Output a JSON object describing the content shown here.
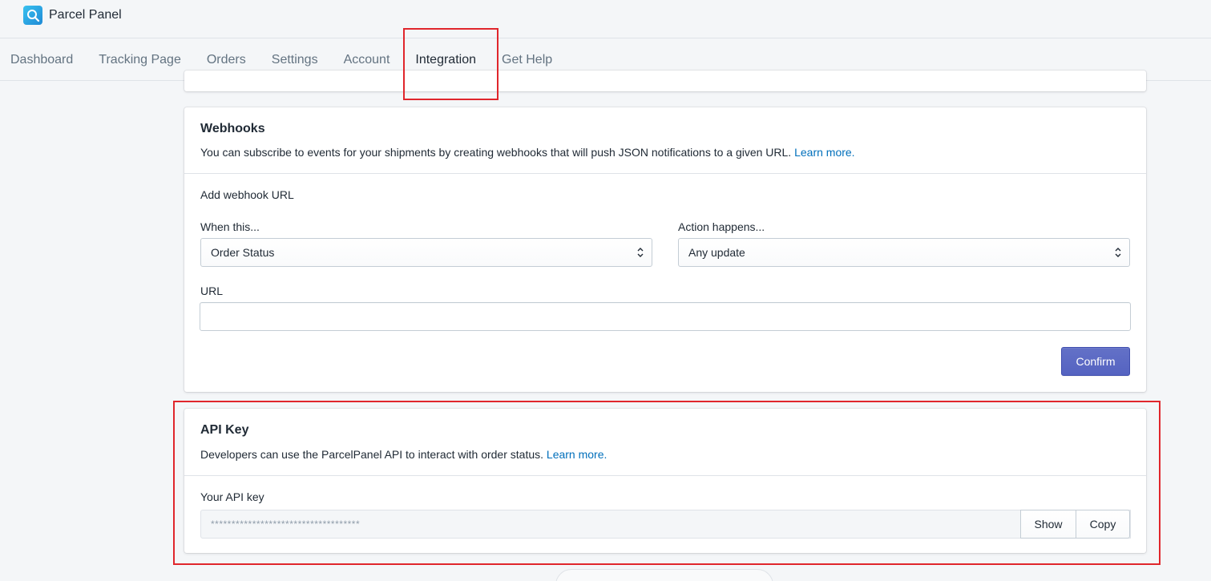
{
  "app": {
    "name": "Parcel Panel"
  },
  "nav": {
    "items": [
      {
        "label": "Dashboard"
      },
      {
        "label": "Tracking Page"
      },
      {
        "label": "Orders"
      },
      {
        "label": "Settings"
      },
      {
        "label": "Account"
      },
      {
        "label": "Integration"
      },
      {
        "label": "Get Help"
      }
    ],
    "active": "Integration"
  },
  "webhooks": {
    "title": "Webhooks",
    "description": "You can subscribe to events for your shipments by creating webhooks that will push JSON notifications to a given URL.",
    "learn_more": "Learn more.",
    "add_title": "Add webhook URL",
    "when_label": "When this...",
    "when_value": "Order Status",
    "action_label": "Action happens...",
    "action_value": "Any update",
    "url_label": "URL",
    "url_value": "",
    "confirm_label": "Confirm"
  },
  "api_key": {
    "title": "API Key",
    "description": "Developers can use the ParcelPanel API to interact with order status.",
    "learn_more": "Learn more.",
    "field_label": "Your API key",
    "masked_value": "************************************",
    "show_label": "Show",
    "copy_label": "Copy"
  },
  "colors": {
    "accent": "#5c6ac4",
    "link": "#006fbb",
    "highlight": "#e0262c"
  }
}
